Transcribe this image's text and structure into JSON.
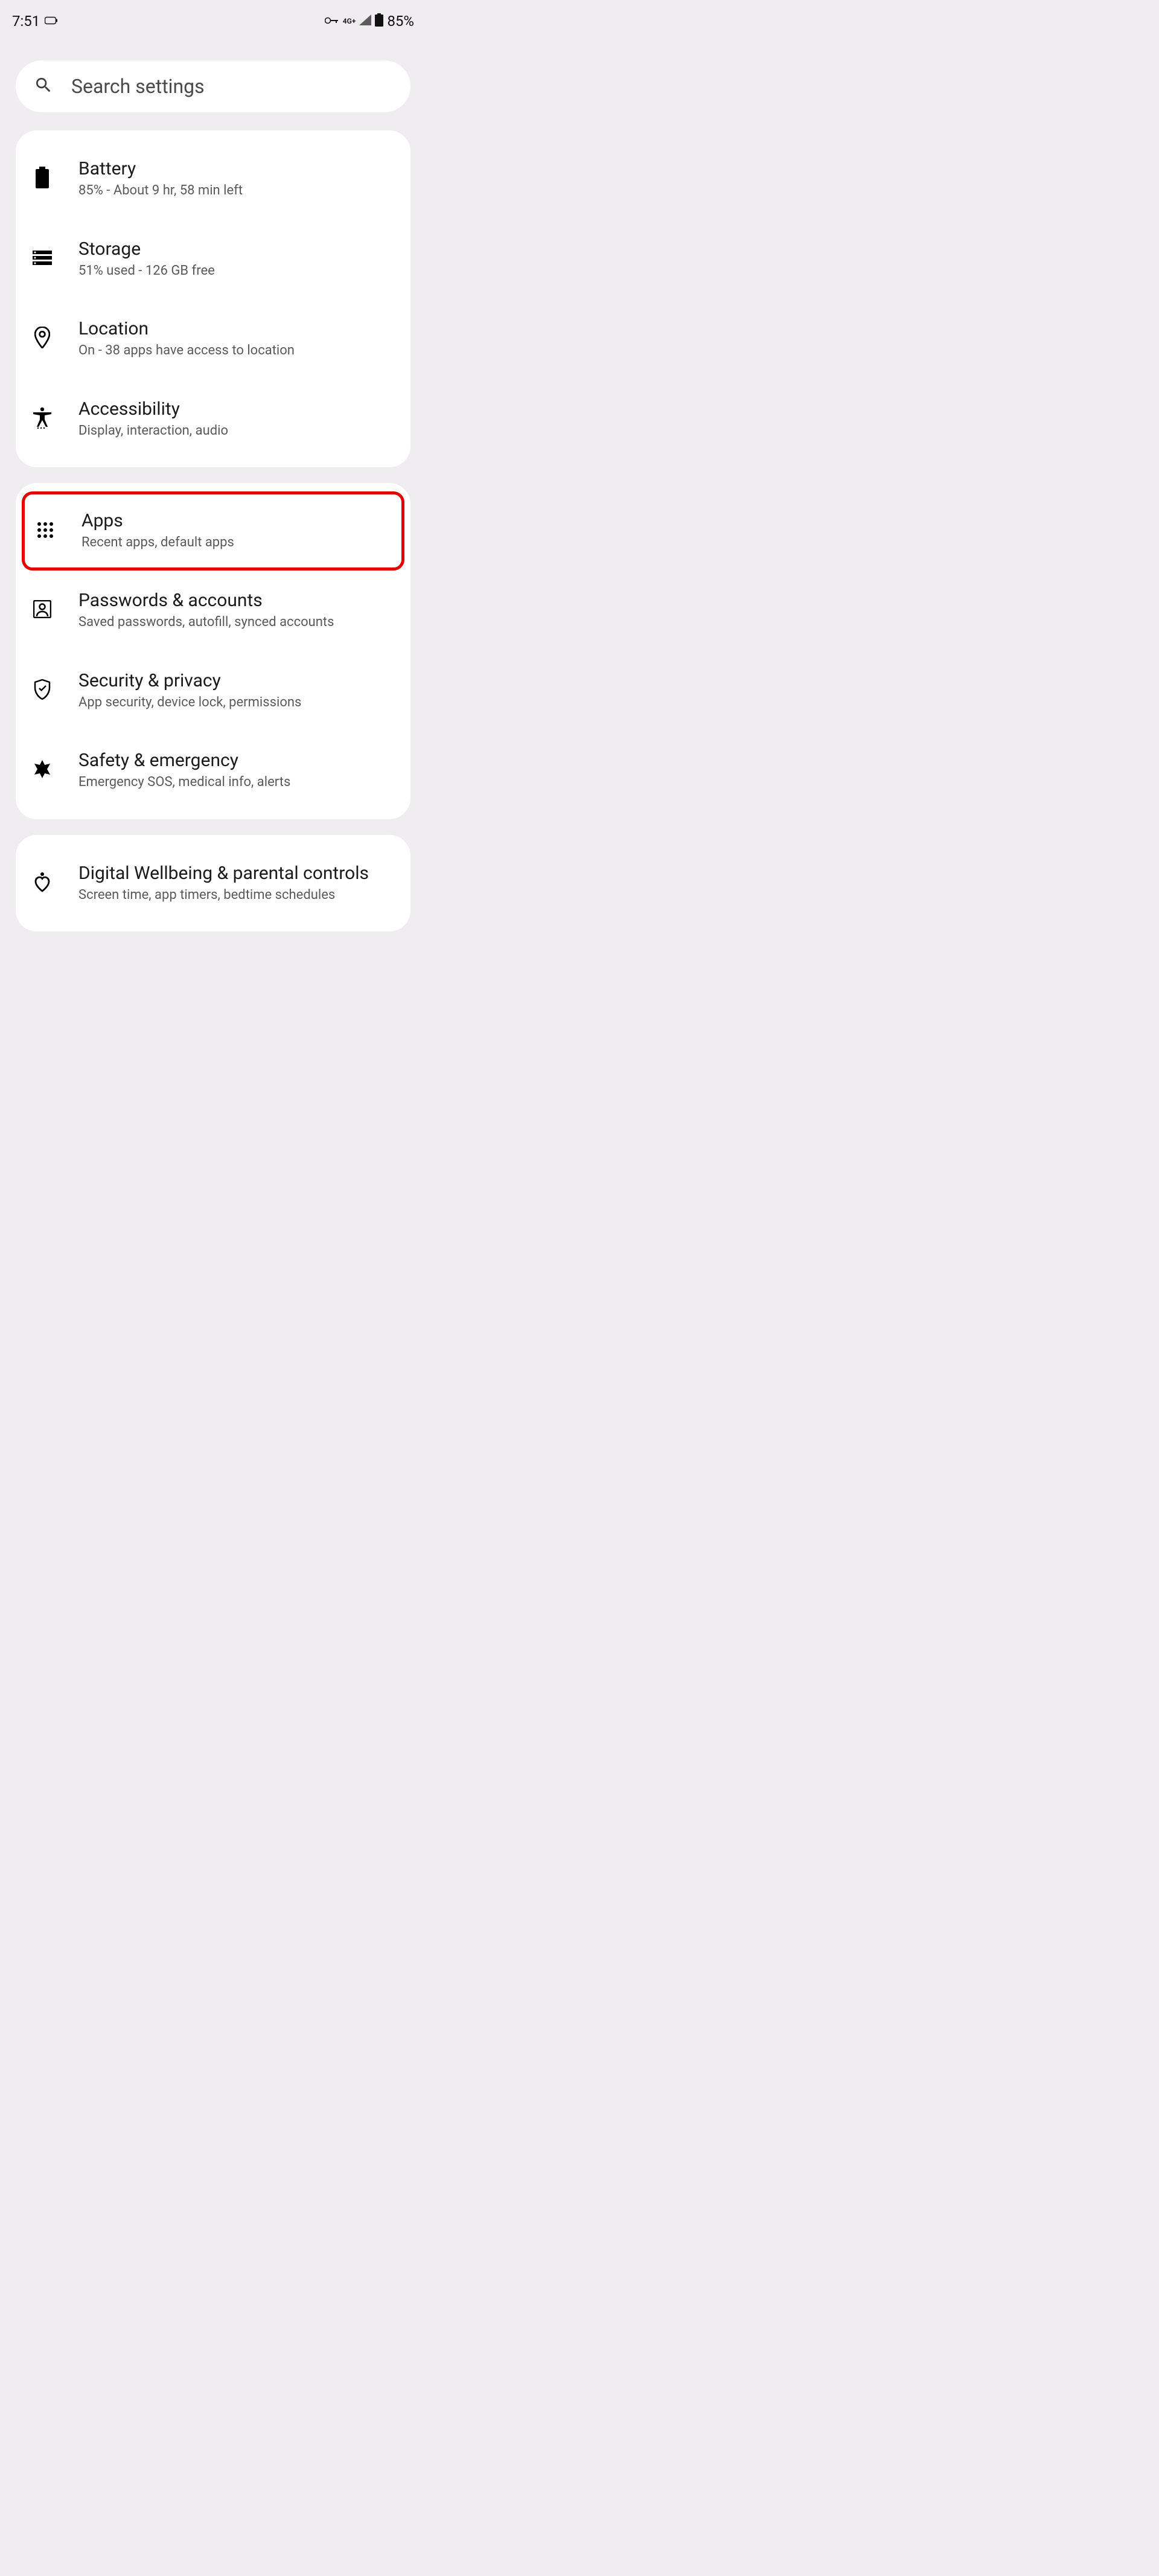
{
  "status": {
    "time": "7:51",
    "battery_pct": "85%",
    "network_label": "4G+"
  },
  "search": {
    "placeholder": "Search settings"
  },
  "groups": [
    {
      "items": [
        {
          "icon": "battery-icon",
          "title": "Battery",
          "subtitle": "85% - About 9 hr, 58 min left"
        },
        {
          "icon": "storage-icon",
          "title": "Storage",
          "subtitle": "51% used - 126 GB free"
        },
        {
          "icon": "location-icon",
          "title": "Location",
          "subtitle": "On - 38 apps have access to location"
        },
        {
          "icon": "accessibility-icon",
          "title": "Accessibility",
          "subtitle": "Display, interaction, audio"
        }
      ]
    },
    {
      "items": [
        {
          "icon": "apps-icon",
          "title": "Apps",
          "subtitle": "Recent apps, default apps",
          "highlighted": true
        },
        {
          "icon": "accounts-icon",
          "title": "Passwords & accounts",
          "subtitle": "Saved passwords, autofill, synced accounts"
        },
        {
          "icon": "security-icon",
          "title": "Security & privacy",
          "subtitle": "App security, device lock, permissions"
        },
        {
          "icon": "emergency-icon",
          "title": "Safety & emergency",
          "subtitle": "Emergency SOS, medical info, alerts"
        }
      ]
    },
    {
      "items": [
        {
          "icon": "wellbeing-icon",
          "title": "Digital Wellbeing & parental controls",
          "subtitle": "Screen time, app timers, bedtime schedules"
        }
      ]
    }
  ]
}
